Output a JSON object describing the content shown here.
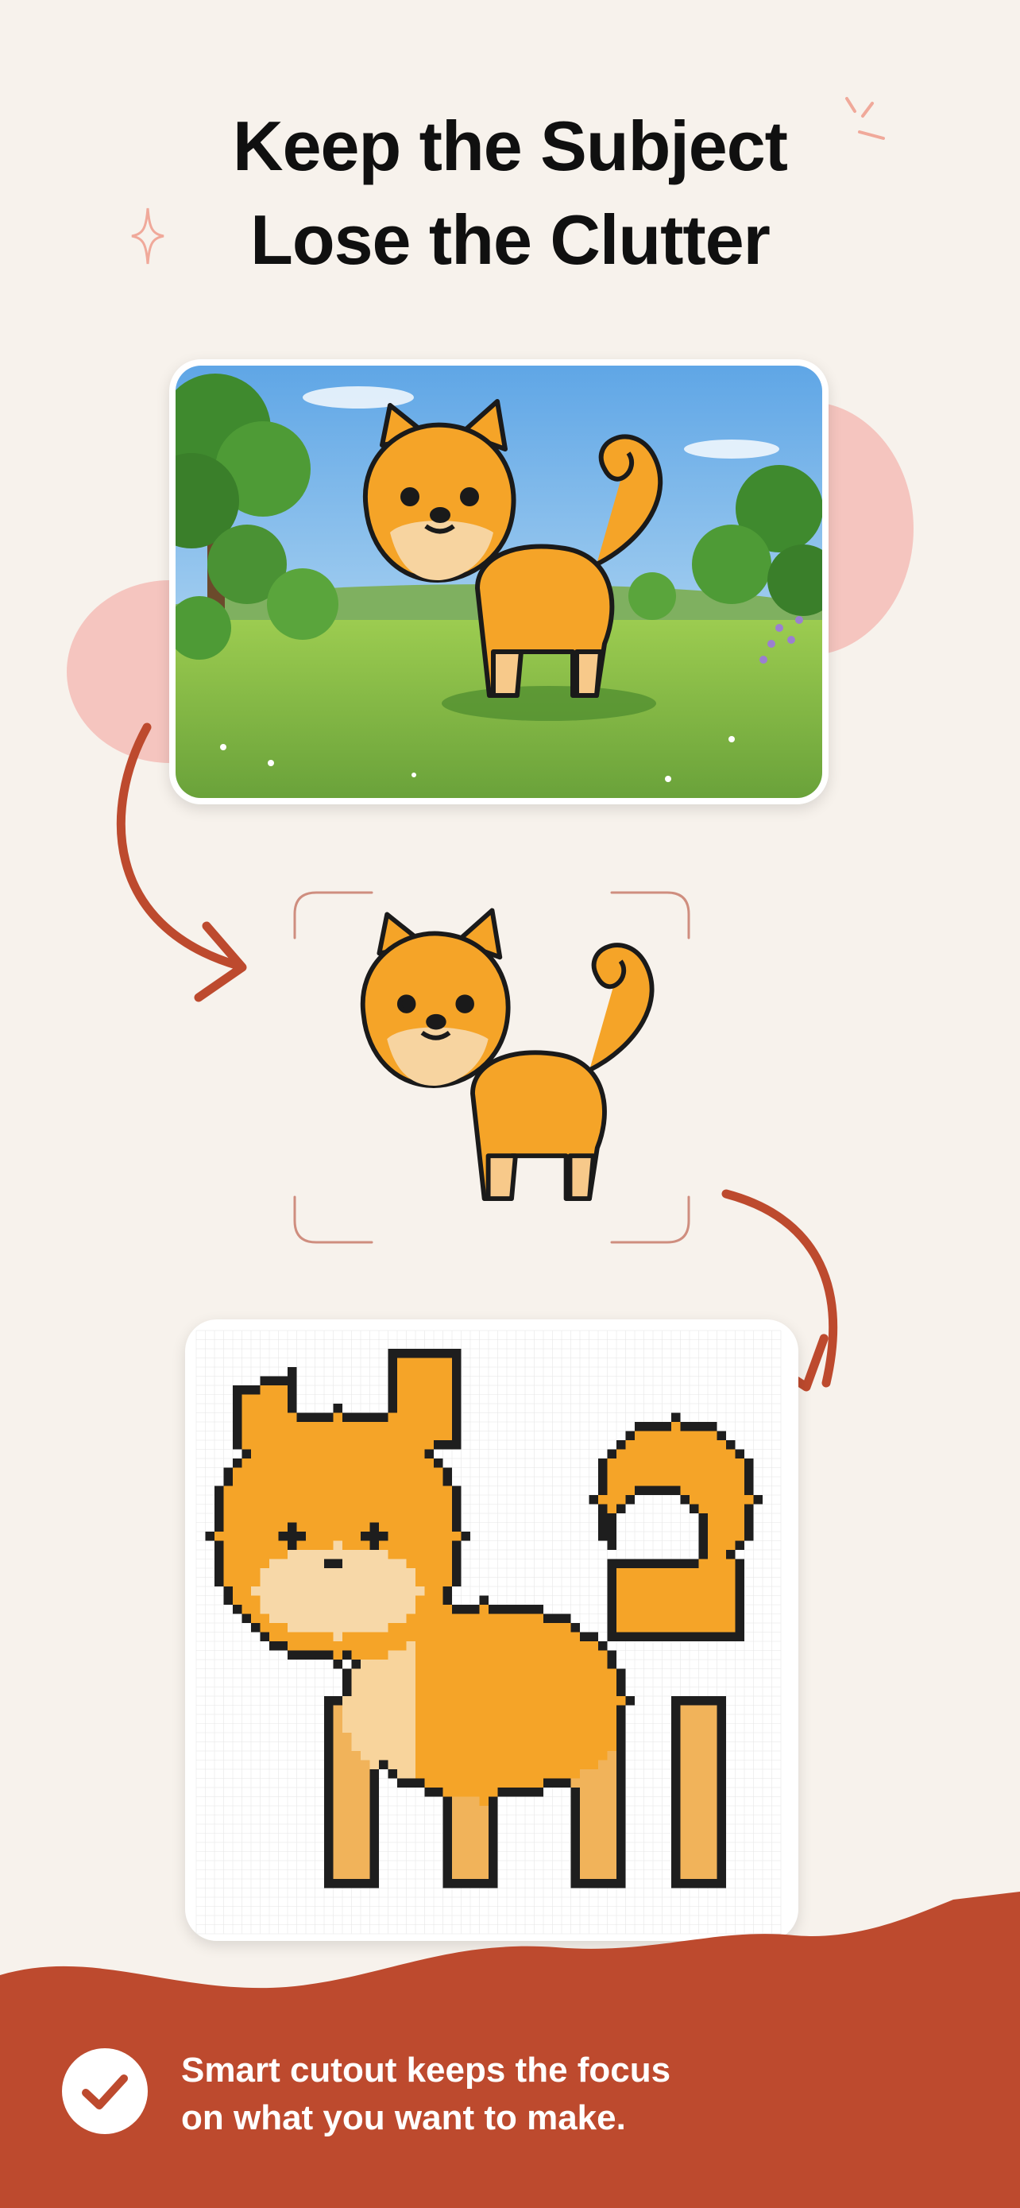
{
  "headline": {
    "line1": "Keep the Subject",
    "line2": "Lose the Clutter"
  },
  "steps": {
    "original": {
      "icon": "shiba-dog-park-photo"
    },
    "cutout": {
      "icon": "shiba-dog-cutout"
    },
    "pattern": {
      "icon": "pixel-pattern-grid"
    }
  },
  "footer": {
    "line1": "Smart cutout keeps the focus",
    "line2": "on what you want to make.",
    "icon": "checkmark-circle-icon"
  },
  "colors": {
    "background": "#f7f2ec",
    "accent": "#bd4a2e",
    "blob": "#f5c5bf",
    "dog": "#f5a428"
  }
}
